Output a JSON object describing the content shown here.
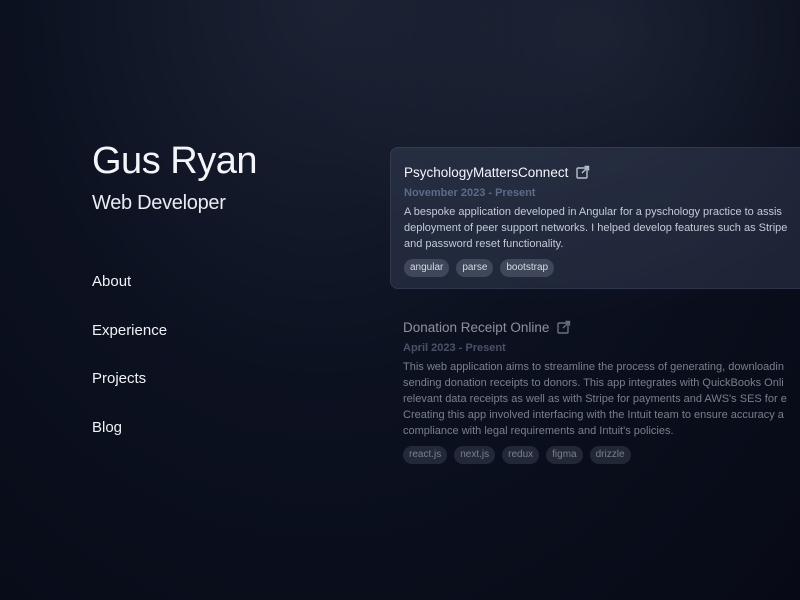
{
  "header": {
    "name": "Gus Ryan",
    "role": "Web Developer"
  },
  "nav": {
    "items": [
      {
        "label": "About"
      },
      {
        "label": "Experience"
      },
      {
        "label": "Projects"
      },
      {
        "label": "Blog"
      }
    ]
  },
  "experience": [
    {
      "title": "PsychologyMattersConnect",
      "date": "November 2023 - Present",
      "description_lines": [
        "A bespoke application developed in Angular for a pyschology practice to assis",
        "deployment of peer support networks. I helped develop features such as Stripe",
        "and password reset functionality."
      ],
      "tags": [
        "angular",
        "parse",
        "bootstrap"
      ],
      "link_icon": "external-link-icon"
    },
    {
      "title": "Donation Receipt Online",
      "date": "April 2023 - Present",
      "description_lines": [
        "This web application aims to streamline the process of generating, downloadin",
        "sending donation receipts to donors. This app integrates with QuickBooks Onli",
        "relevant data receipts as well as with Stripe for payments and AWS's SES for e",
        "Creating this app involved interfacing with the Intuit team to ensure accuracy a",
        "compliance with legal requirements and Intuit's policies."
      ],
      "tags": [
        "react.js",
        "next.js",
        "redux",
        "figma",
        "drizzle"
      ],
      "link_icon": "external-link-icon"
    }
  ],
  "colors": {
    "background": "#0c1120",
    "card_highlight": "#3c465c",
    "date_text": "#5d6b86",
    "tag_bg": "#788296"
  }
}
